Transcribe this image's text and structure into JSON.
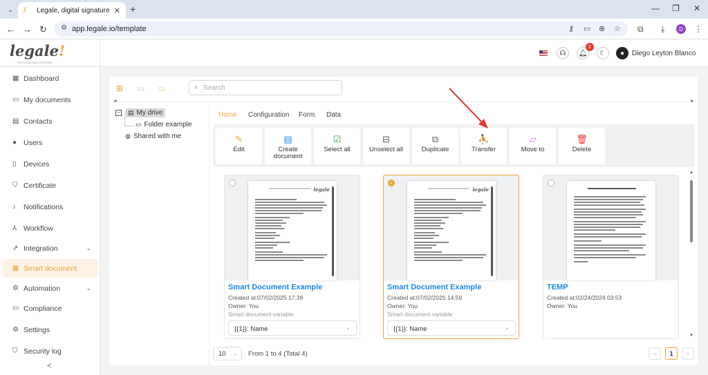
{
  "browser": {
    "tab_title": "Legale, digital signature",
    "url": "app.legale.io/template"
  },
  "header": {
    "logo": "legale",
    "logo_mark": "!",
    "logo_tagline": "THE LEGAL WAY FORWARD",
    "notification_count": "2",
    "user_name": "Diego Leyton Blanco"
  },
  "sidebar": {
    "items": [
      {
        "label": "Dashboard",
        "icon": "dashboard-icon"
      },
      {
        "label": "My documents",
        "icon": "folder-icon"
      },
      {
        "label": "Contacts",
        "icon": "contacts-icon"
      },
      {
        "label": "Users",
        "icon": "user-icon"
      },
      {
        "label": "Devices",
        "icon": "device-icon"
      },
      {
        "label": "Certificate",
        "icon": "shield-icon"
      },
      {
        "label": "Notifications",
        "icon": "bell-icon"
      },
      {
        "label": "Workflow",
        "icon": "workflow-icon"
      },
      {
        "label": "Integration",
        "icon": "integration-icon"
      },
      {
        "label": "Smart document",
        "icon": "smart-document-icon"
      },
      {
        "label": "Automation",
        "icon": "automation-icon"
      },
      {
        "label": "Compliance",
        "icon": "compliance-icon"
      },
      {
        "label": "Settings",
        "icon": "gear-icon"
      },
      {
        "label": "Security log",
        "icon": "security-log-icon"
      }
    ],
    "active": "Smart document",
    "collapse_glyph": "<"
  },
  "search": {
    "placeholder": "Search"
  },
  "tree": {
    "root": "My drive",
    "child": "Folder example",
    "shared": "Shared with me"
  },
  "menu_tabs": [
    "Home",
    "Configuration",
    "Form",
    "Data"
  ],
  "toolbar": [
    {
      "label": "Edit",
      "icon": "pencil-icon"
    },
    {
      "label": "Create document",
      "icon": "create-document-icon"
    },
    {
      "label": "Select all",
      "icon": "select-all-icon"
    },
    {
      "label": "Unselect all",
      "icon": "unselect-all-icon"
    },
    {
      "label": "Duplicate",
      "icon": "duplicate-icon"
    },
    {
      "label": "Transfer",
      "icon": "transfer-icon"
    },
    {
      "label": "Move to",
      "icon": "move-to-icon"
    },
    {
      "label": "Delete",
      "icon": "trash-icon"
    }
  ],
  "documents": [
    {
      "name": "Smart Document Example",
      "created": "Created at:07/02/2025 17:39",
      "owner": "Owner: You",
      "variable_label": "Smart document variable",
      "variable_value": "{{1}}: Name",
      "selected": false
    },
    {
      "name": "Smart Document Example",
      "created": "Created at:07/02/2025 14:59",
      "owner": "Owner: You",
      "variable_label": "Smart document variable",
      "variable_value": "{{1}}: Name",
      "selected": true
    },
    {
      "name": "TEMP",
      "created": "Created at:02/24/2024 03:53",
      "owner": "Owner: You",
      "selected": false
    }
  ],
  "footer": {
    "page_size": "10",
    "info": "From 1 to 4 (Total 4)",
    "current_page": "1"
  },
  "colors": {
    "accent": "#e8a53a",
    "link": "#1e88e5",
    "annotation_arrow": "#e53935"
  }
}
